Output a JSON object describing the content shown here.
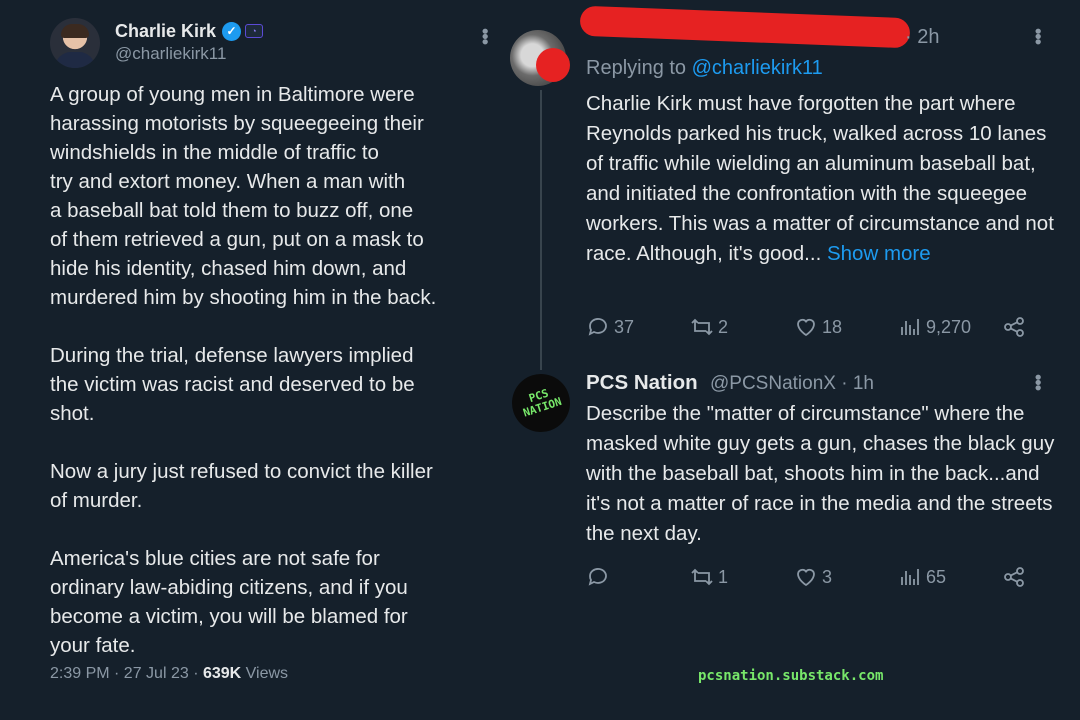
{
  "original_tweet": {
    "author_name": "Charlie Kirk",
    "author_handle": "@charliekirk11",
    "text": "A group of young men in Baltimore were\nharassing motorists by squeegeeing their\nwindshields in the middle of traffic to\ntry and extort money. When a man with\na baseball bat told them to buzz off, one\nof them retrieved a gun, put on a mask to\nhide his identity, chased him down, and\nmurdered him by shooting him in the back.\n\nDuring the trial, defense lawyers implied\nthe victim was racist and deserved to be\nshot.\n\nNow a jury just refused to convict the killer\nof murder.\n\nAmerica's blue cities are not safe for\nordinary law-abiding citizens, and if you\nbecome a victim, you will be blamed for\nyour fate.",
    "timestamp": "2:39 PM · 27 Jul 23 · ",
    "views_count": "639K",
    "views_label": " Views"
  },
  "reply_1": {
    "time": "· 2h",
    "replying_prefix": "Replying to ",
    "replying_handle": "@charliekirk11",
    "text": "Charlie Kirk must have forgotten the part where Reynolds parked his truck, walked across 10 lanes of traffic while wielding an aluminum baseball bat, and initiated the confrontation with the squeegee workers. This was a matter of circumstance and not race. Although, it's good... ",
    "show_more": "Show more",
    "replies": "37",
    "reposts": "2",
    "likes": "18",
    "views": "9,270"
  },
  "reply_2": {
    "avatar_text": "PCS NATION",
    "author_name": "PCS Nation",
    "author_handle": "@PCSNationX · 1h",
    "text": "Describe the \"matter of circumstance\" where the masked white guy gets a gun, chases the black guy with the baseball bat, shoots him in the back...and it's not a matter of race in the media and the streets the next day.",
    "replies": "",
    "reposts": "1",
    "likes": "3",
    "views": "65"
  },
  "watermark": "pcsnation.substack.com",
  "colors": {
    "background": "#15202b",
    "text": "#e7e9ea",
    "muted": "#8b98a5",
    "link": "#1d9bf0",
    "redaction": "#e62222",
    "watermark": "#78e86a"
  }
}
